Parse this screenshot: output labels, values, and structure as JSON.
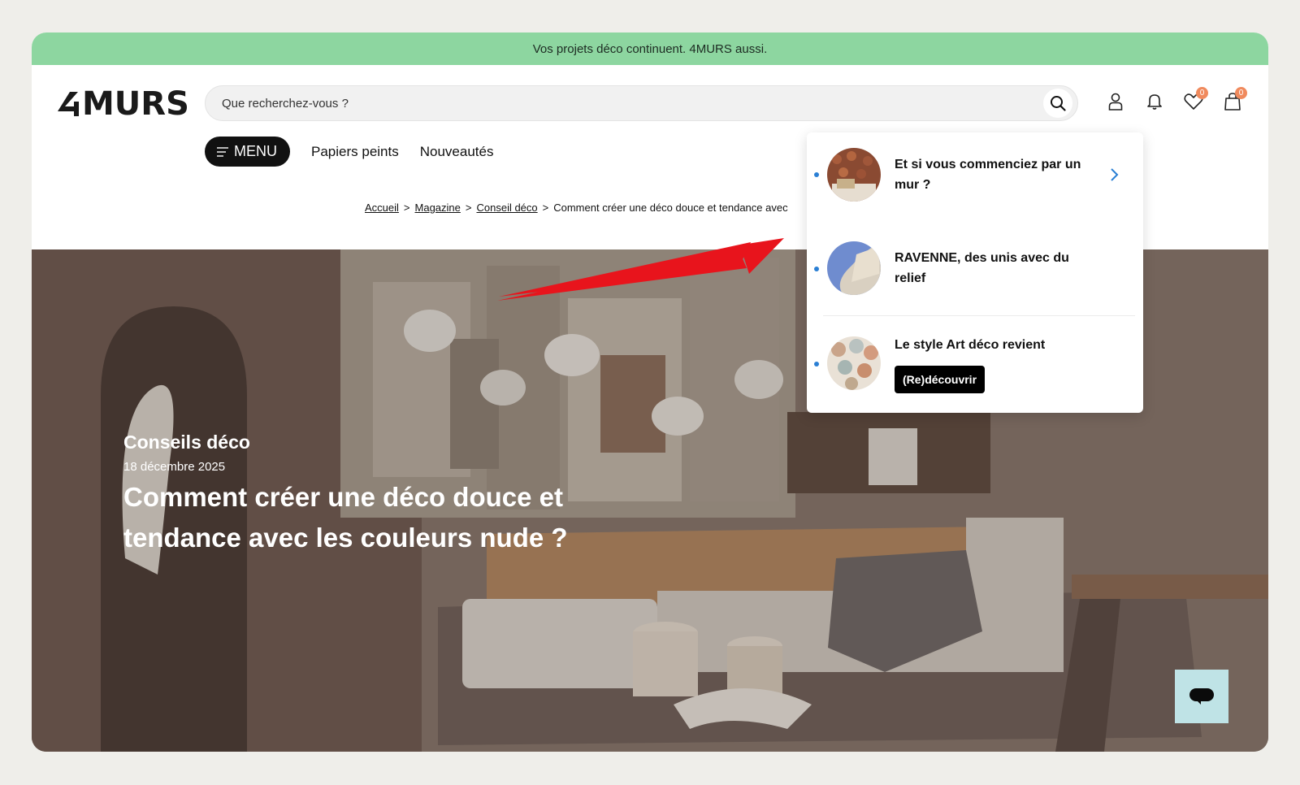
{
  "promo": {
    "text": "Vos projets déco continuent. 4MURS aussi."
  },
  "brand": {
    "name": "MURS"
  },
  "search": {
    "placeholder": "Que recherchez-vous ?"
  },
  "header": {
    "wishlist_count": "0",
    "cart_count": "0"
  },
  "nav": {
    "menu_label": "MENU",
    "links": [
      "Papiers peints",
      "Nouveautés"
    ]
  },
  "breadcrumb": {
    "items": [
      "Accueil",
      "Magazine",
      "Conseil déco"
    ],
    "separator": ">",
    "current": "Comment créer une déco douce et tendance avec"
  },
  "hero": {
    "category": "Conseils déco",
    "date": "18 décembre 2025",
    "title": "Comment créer une déco douce et tendance avec les couleurs nude ?"
  },
  "notifications": {
    "items": [
      {
        "text": "Et si vous commenciez par un mur ?"
      },
      {
        "text": "RAVENNE, des unis avec du relief"
      },
      {
        "text": "Le style Art déco revient",
        "button": "(Re)découvrir"
      }
    ]
  },
  "colors": {
    "promo_bg": "#8dd6a0",
    "badge": "#f08a5d",
    "unread_dot": "#2a7fd4",
    "arrow": "#e8141c",
    "chat_bg": "#bfe3e6"
  }
}
